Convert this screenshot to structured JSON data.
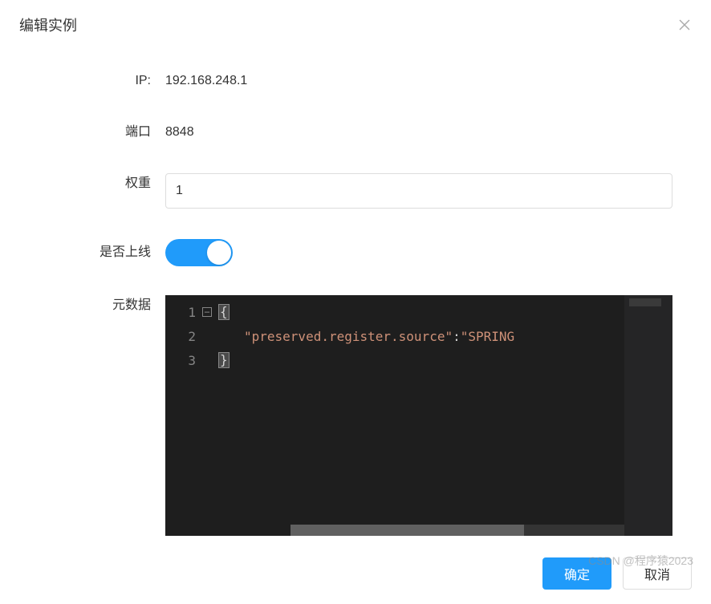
{
  "dialog": {
    "title": "编辑实例"
  },
  "form": {
    "ip_label": "IP:",
    "ip_value": "192.168.248.1",
    "port_label": "端口",
    "port_value": "8848",
    "weight_label": "权重",
    "weight_value": "1",
    "online_label": "是否上线",
    "online_value": true,
    "metadata_label": "元数据"
  },
  "editor": {
    "gutter": [
      "1",
      "2",
      "3"
    ],
    "fold_glyph": "−",
    "line1_brace": "{",
    "line2_indent": "    ",
    "line2_key": "\"preserved.register.source\"",
    "line2_colon": ":",
    "line2_value": " \"SPRING",
    "line3_brace": "}"
  },
  "footer": {
    "ok_label": "确定",
    "cancel_label": "取消"
  },
  "watermark": "CSDN @程序猿2023"
}
